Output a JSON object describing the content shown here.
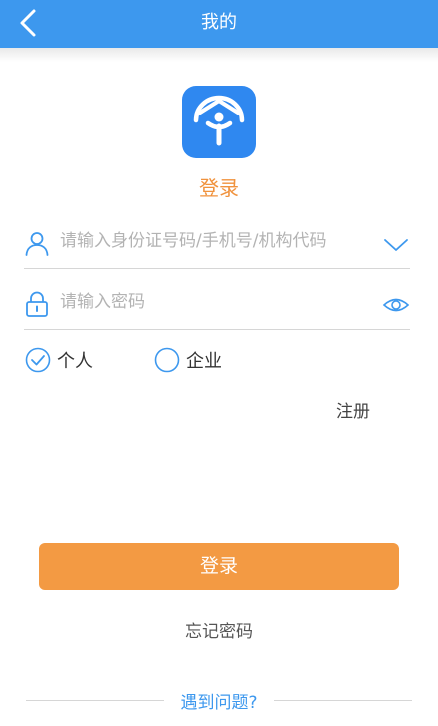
{
  "header": {
    "title": "我的",
    "back_icon": "chevron-left-icon"
  },
  "logo": {
    "icon": "app-logo-icon",
    "color": "#2f88f0"
  },
  "login_title": "登录",
  "id_field": {
    "placeholder": "请输入身份证号码/手机号/机构代码",
    "value": "",
    "left_icon": "user-icon",
    "right_icon": "chevron-down-icon"
  },
  "password_field": {
    "placeholder": "请输入密码",
    "value": "",
    "left_icon": "lock-icon",
    "right_icon": "eye-icon"
  },
  "account_type": {
    "options": [
      "个人",
      "企业"
    ],
    "selected": "个人"
  },
  "register_label": "注册",
  "login_button_label": "登录",
  "forgot_password_label": "忘记密码",
  "help_label": "遇到问题?",
  "colors": {
    "header": "#3d98ee",
    "accent": "#f39a43",
    "link": "#3d98ee"
  }
}
